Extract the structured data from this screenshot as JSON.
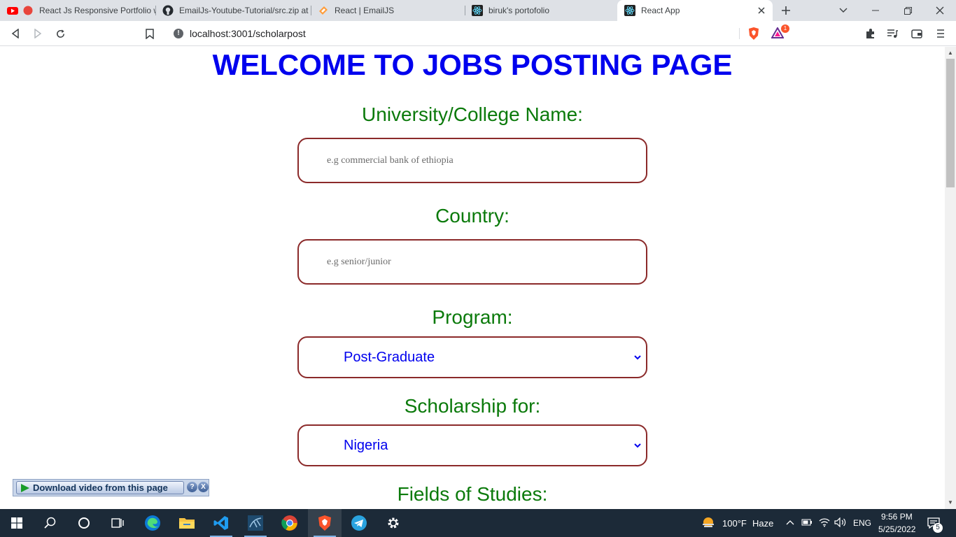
{
  "browser": {
    "tabs": [
      {
        "label": "React Js Responsive Portfolio w",
        "favicon": "youtube-icon"
      },
      {
        "label": "EmailJs-Youtube-Tutorial/src.zip at",
        "favicon": "github-icon"
      },
      {
        "label": "React | EmailJS",
        "favicon": "emailjs-icon"
      },
      {
        "label": "biruk's portofolio",
        "favicon": "react-icon"
      },
      {
        "label": "React App",
        "favicon": "react-icon",
        "active": true
      }
    ],
    "url": "localhost:3001/scholarpost",
    "brave_badge_count": "1"
  },
  "page": {
    "title": "WELCOME TO JOBS POSTING PAGE",
    "fields": {
      "university": {
        "label": "University/College Name:",
        "placeholder": "e.g commercial bank of ethiopia"
      },
      "country": {
        "label": "Country:",
        "placeholder": "e.g senior/junior"
      },
      "program": {
        "label": "Program:",
        "selected": "Post-Graduate"
      },
      "scholarship_for": {
        "label": "Scholarship for:",
        "selected": "Nigeria"
      },
      "fields_of_studies": {
        "label": "Fields of Studies:"
      }
    },
    "colors": {
      "title": "#0000ee",
      "labels": "#0b7a0b",
      "field_border": "#8b2a2a",
      "select_text": "#0000ee"
    }
  },
  "download_bar": {
    "button_label": "Download video from this page",
    "help_label": "?",
    "close_label": "X"
  },
  "taskbar": {
    "weather_temp": "100°F",
    "weather_desc": "Haze",
    "language": "ENG",
    "time": "9:56 PM",
    "date": "5/25/2022",
    "notification_count": "5"
  }
}
